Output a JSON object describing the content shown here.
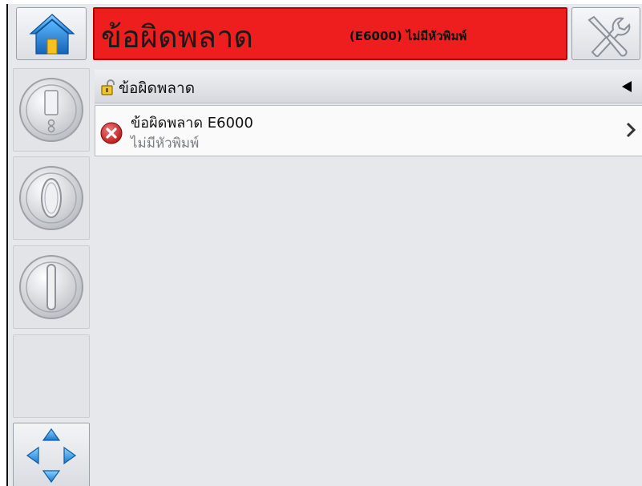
{
  "banner": {
    "title": "ข้อผิดพลาด",
    "detail": "(E6000) ไม่มีหัวพิมพ์",
    "color": "#ee1e1e"
  },
  "toolbar": {
    "home_icon": "home-icon",
    "tools_icon": "tools-icon"
  },
  "sidebar": {
    "buttons": [
      {
        "icon": "nozzle-icon"
      },
      {
        "icon": "power-off-icon"
      },
      {
        "icon": "power-on-icon"
      },
      {
        "icon": "blank"
      },
      {
        "icon": "navigation-arrows-icon"
      }
    ]
  },
  "section": {
    "title": "ข้อผิดพลาด",
    "lock_icon": "padlock-icon",
    "collapse_icon": "collapse-arrow-icon"
  },
  "alerts": [
    {
      "title": "ข้อผิดพลาด E6000",
      "subtitle": "ไม่มีหัวพิมพ์",
      "icon": "error-x-icon"
    }
  ]
}
